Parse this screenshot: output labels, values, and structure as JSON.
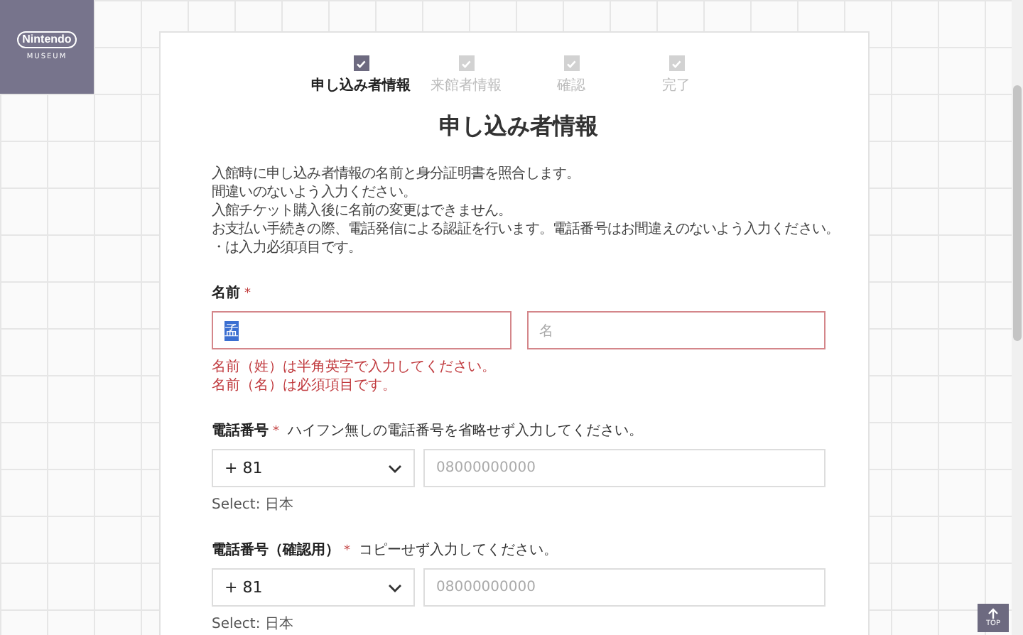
{
  "logo": {
    "brand": "Nintendo",
    "sub": "MUSEUM"
  },
  "steps": [
    {
      "label": "申し込み者情報",
      "selected": true
    },
    {
      "label": "来館者情報",
      "selected": false
    },
    {
      "label": "確認",
      "selected": false
    },
    {
      "label": "完了",
      "selected": false
    }
  ],
  "title": "申し込み者情報",
  "intro": [
    "入館時に申し込み者情報の名前と身分証明書を照合します。",
    "間違いのないよう入力ください。",
    "入館チケット購入後に名前の変更はできません。",
    "お支払い手続きの際、電話発信による認証を行います。電話番号はお間違えのないよう入力ください。",
    "・は入力必須項目です。"
  ],
  "name_field": {
    "label": "名前",
    "required_mark": "*",
    "inputs": [
      {
        "value": "孟",
        "error": true,
        "highlighted": true
      },
      {
        "placeholder": "名",
        "error": true
      }
    ],
    "errors": [
      "名前（姓）は半角英字で入力してください。",
      "名前（名）は必須項目です。"
    ]
  },
  "phone_fields": [
    {
      "label": "電話番号",
      "required_mark": "*",
      "hint": "ハイフン無しの電話番号を省略せず入力してください。",
      "country_code": "+ 81",
      "placeholder": "08000000000",
      "select_note": "Select: 日本"
    },
    {
      "label": "電話番号（確認用）",
      "required_mark": "*",
      "hint": "コピーせず入力してください。",
      "country_code": "+ 81",
      "placeholder": "08000000000",
      "select_note": "Select: 日本"
    }
  ],
  "top_button": {
    "label": "TOP"
  }
}
